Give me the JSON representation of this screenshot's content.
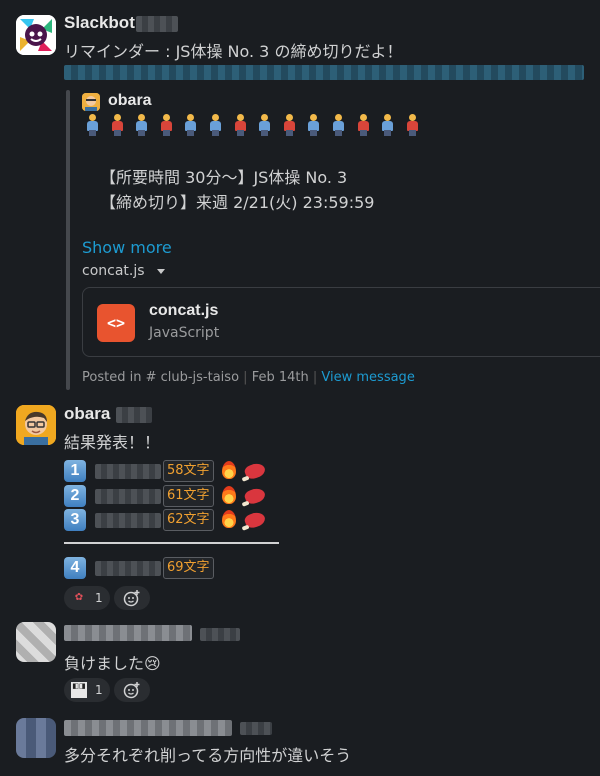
{
  "messages": [
    {
      "sender": "Slackbot",
      "text": "リマインダー : JS体操 No. 3 の締め切りだよ！",
      "quote": {
        "author": "obara",
        "line1": "【所要時間 30分〜】JS体操 No. 3",
        "line2": "【締め切り】来週 2/21(火) 23:59:59",
        "show_more": "Show more",
        "attachment_label": "concat.js",
        "file": {
          "name": "concat.js",
          "type": "JavaScript",
          "icon": "<>"
        },
        "posted_in_prefix": "Posted in",
        "channel": "# club-js-taiso",
        "date": "Feb 14th",
        "view_message": "View message"
      }
    },
    {
      "sender": "obara",
      "text": "結果発表！！",
      "results": [
        {
          "rank": "1",
          "count": "58文字"
        },
        {
          "rank": "2",
          "count": "61文字"
        },
        {
          "rank": "3",
          "count": "62文字"
        },
        {
          "rank": "4",
          "count": "69文字"
        }
      ],
      "reaction_count": "1"
    },
    {
      "text": "負けました😢",
      "reaction_count": "1"
    },
    {
      "text": "多分それぞれ削ってる方向性が違いそう"
    }
  ],
  "colors": {
    "background": "#1a1d21",
    "link": "#1d9bd1",
    "accent_orange": "#e8542f",
    "count_text": "#f0a030"
  }
}
